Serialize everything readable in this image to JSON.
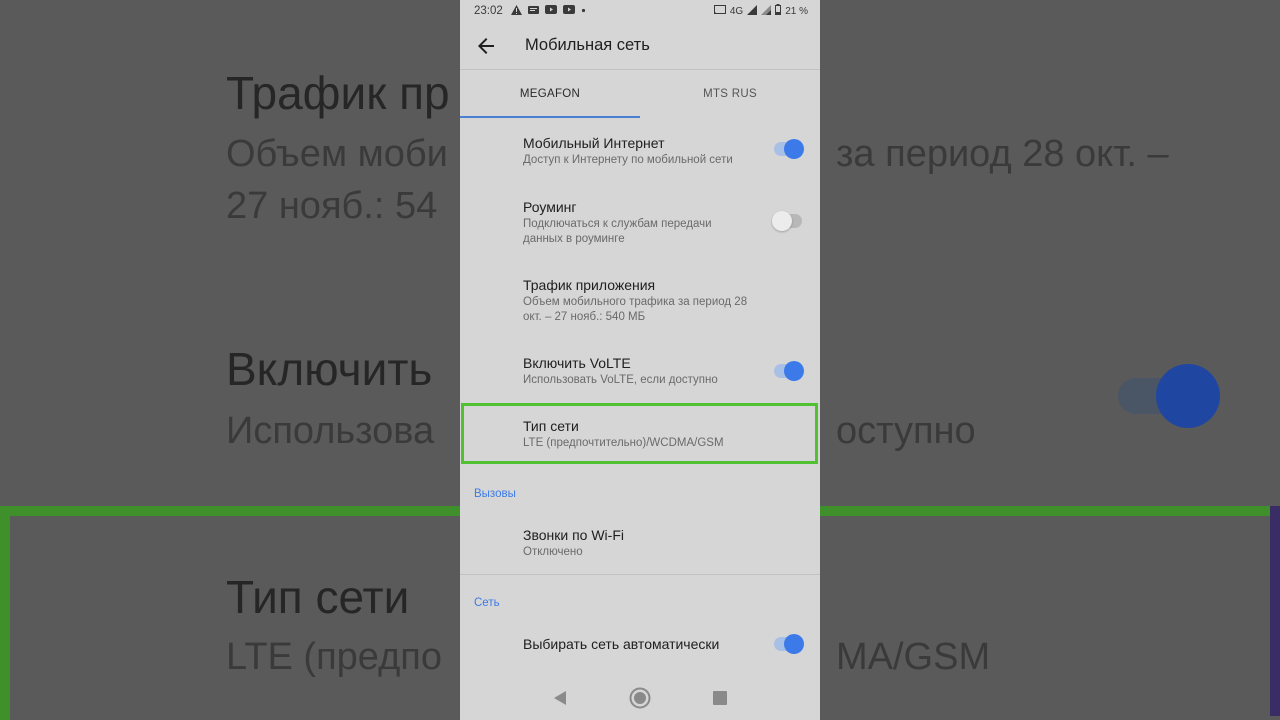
{
  "background": {
    "title1": "Трафик пр",
    "sub1a": "Объем моби",
    "sub1b": "за период 28 окт. –",
    "sub1c": "27 нояб.: 54",
    "title2": "Включить",
    "sub2a": "Использова",
    "sub2b": "оступно",
    "title3": "Тип сети",
    "sub3a": "LTE (предпо",
    "sub3b": "MA/GSM"
  },
  "status_bar": {
    "time": "23:02",
    "network": "4G",
    "battery": "21 %"
  },
  "app_bar": {
    "title": "Мобильная сеть"
  },
  "tabs": [
    {
      "label": "MEGAFON",
      "active": true
    },
    {
      "label": "MTS RUS",
      "active": false
    }
  ],
  "items": [
    {
      "title": "Мобильный Интернет",
      "subtitle": "Доступ к Интернету по мобильной сети",
      "toggle": "on"
    },
    {
      "title": "Роуминг",
      "subtitle": "Подключаться к службам передачи данных в роуминге",
      "toggle": "off"
    },
    {
      "title": "Трафик приложения",
      "subtitle": "Объем мобильного трафика за период 28 окт. – 27 нояб.: 540 МБ"
    },
    {
      "title": "Включить VoLTE",
      "subtitle": "Использовать VoLTE, если доступно",
      "toggle": "on"
    },
    {
      "title": "Тип сети",
      "subtitle": "LTE (предпочтительно)/WCDMA/GSM",
      "highlighted": true
    }
  ],
  "sections": {
    "calls": {
      "header": "Вызовы",
      "items": [
        {
          "title": "Звонки по Wi-Fi",
          "subtitle": "Отключено"
        }
      ]
    },
    "network": {
      "header": "Сеть",
      "items": [
        {
          "title": "Выбирать сеть автоматически",
          "toggle": "on"
        }
      ]
    }
  },
  "colors": {
    "accent": "#3b7ae8",
    "highlight": "#4fc132",
    "screen_bg": "#d6d6d6"
  }
}
